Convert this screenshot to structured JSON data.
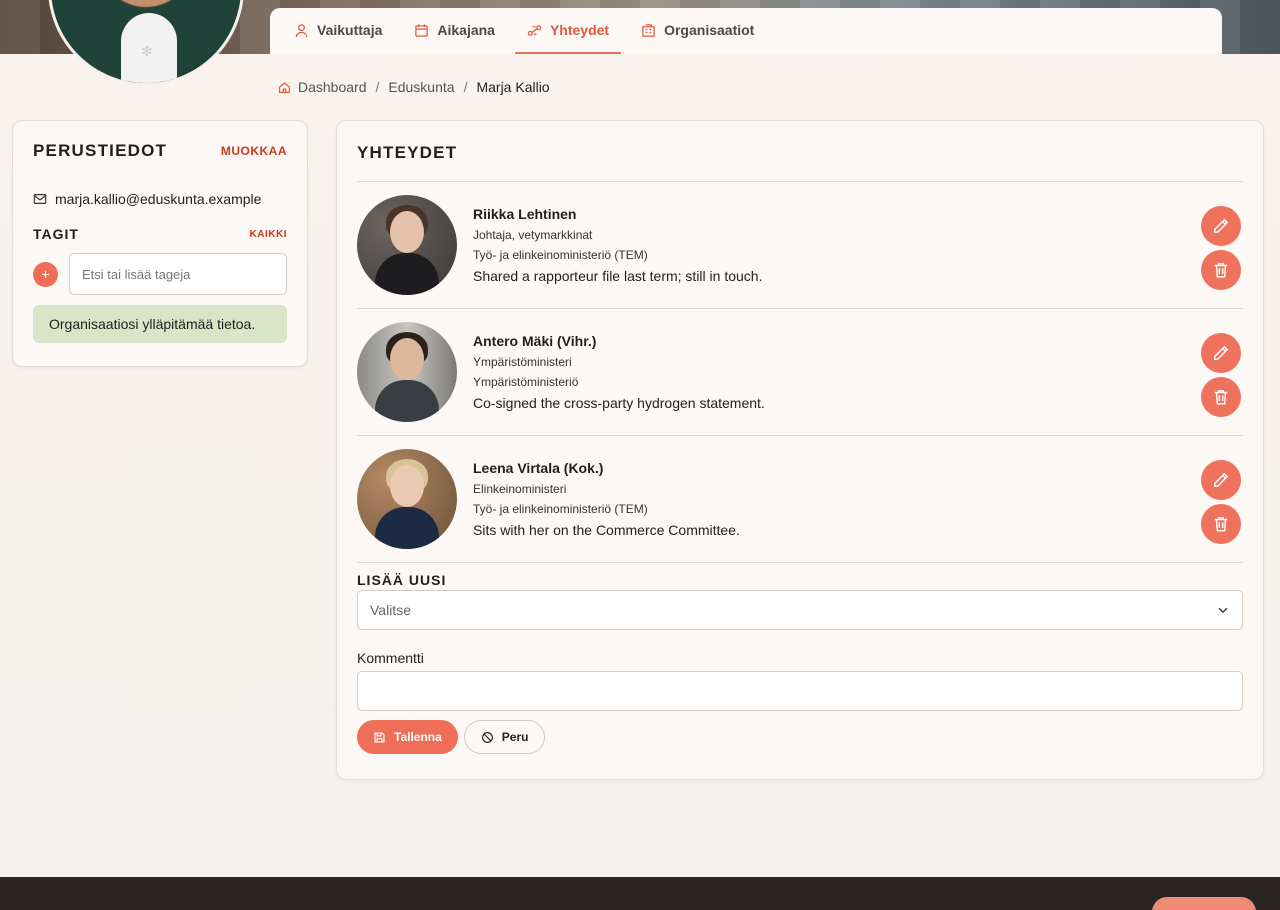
{
  "tabs": [
    {
      "label": "Vaikuttaja",
      "icon": "person-icon",
      "active": false
    },
    {
      "label": "Aikajana",
      "icon": "calendar-icon",
      "active": false
    },
    {
      "label": "Yhteydet",
      "icon": "connections-icon",
      "active": true
    },
    {
      "label": "Organisaatiot",
      "icon": "building-icon",
      "active": false
    }
  ],
  "breadcrumb": {
    "items": [
      "Dashboard",
      "Eduskunta",
      "Marja Kallio"
    ],
    "separator": "/"
  },
  "basics": {
    "title": "PERUSTIEDOT",
    "edit_label": "MUOKKAA",
    "email": "marja.kallio@eduskunta.example",
    "tags_title": "TAGIT",
    "tags_all_label": "KAIKKI",
    "tag_add_symbol": "+",
    "tag_input_placeholder": "Etsi tai lisää tageja",
    "info_text": "Organisaatiosi ylläpitämää tietoa."
  },
  "connections": {
    "title": "YHTEYDET",
    "items": [
      {
        "name": "Riikka Lehtinen",
        "role": "Johtaja, vetymarkkinat",
        "organization": "Työ- ja elinkeinoministeriö (TEM)",
        "comment": "Shared a rapporteur file last term; still in touch."
      },
      {
        "name": "Antero Mäki (Vihr.)",
        "role": "Ympäristöministeri",
        "organization": "Ympäristöministeriö",
        "comment": "Co-signed the cross-party hydrogen statement."
      },
      {
        "name": "Leena Virtala (Kok.)",
        "role": "Elinkeinoministeri",
        "organization": "Työ- ja elinkeinoministeriö (TEM)",
        "comment": "Sits with her on the Commerce Committee."
      }
    ]
  },
  "add_new": {
    "title": "LISÄÄ UUSI",
    "select_value": "Valitse",
    "comment_label": "Kommentti",
    "comment_value": "",
    "save_label": "Tallenna",
    "cancel_label": "Peru"
  },
  "colors": {
    "accent": "#ef6e58",
    "accent_text": "#e0573e",
    "info_bg": "#d9e5c6",
    "footer_bg": "#2a2523"
  }
}
